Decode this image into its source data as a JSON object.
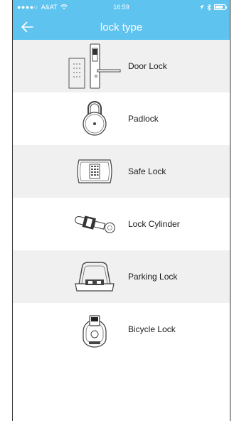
{
  "status_bar": {
    "carrier": "A&AT",
    "signal_dots": "●●●●○",
    "time": "16:59",
    "battery_level": 0.8
  },
  "nav": {
    "title": "lock type",
    "back_icon": "arrow-left-icon"
  },
  "lock_types": [
    {
      "label": "Door Lock",
      "icon": "door-lock-icon"
    },
    {
      "label": "Padlock",
      "icon": "padlock-icon"
    },
    {
      "label": "Safe Lock",
      "icon": "safe-lock-icon"
    },
    {
      "label": "Lock Cylinder",
      "icon": "lock-cylinder-icon"
    },
    {
      "label": "Parking Lock",
      "icon": "parking-lock-icon"
    },
    {
      "label": "Bicycle Lock",
      "icon": "bicycle-lock-icon"
    }
  ],
  "colors": {
    "accent": "#5ec3ef",
    "row_shade": "#f0f0f0"
  }
}
